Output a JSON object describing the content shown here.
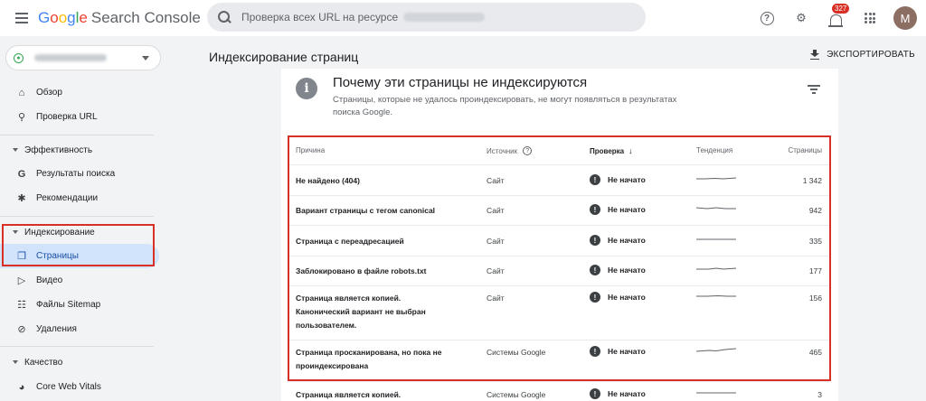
{
  "app": {
    "logo_g": "G",
    "logo_o1": "o",
    "logo_o2": "o",
    "logo_g2": "g",
    "logo_l": "l",
    "logo_e": "e",
    "product": "Search Console"
  },
  "search": {
    "placeholder": "Проверка всех URL на ресурсе"
  },
  "header": {
    "notifications_count": "327",
    "avatar_letter": "M"
  },
  "sidebar": {
    "items": [
      {
        "label": "Обзор",
        "icon": "home-icon"
      },
      {
        "label": "Проверка URL",
        "icon": "search-icon"
      }
    ],
    "sections": [
      {
        "label": "Эффективность",
        "items": [
          {
            "label": "Результаты поиска",
            "icon": "google-g-icon"
          },
          {
            "label": "Рекомендации",
            "icon": "asterisk-icon"
          }
        ]
      },
      {
        "label": "Индексирование",
        "items": [
          {
            "label": "Страницы",
            "icon": "pages-icon",
            "active": true
          },
          {
            "label": "Видео",
            "icon": "video-icon"
          },
          {
            "label": "Файлы Sitemap",
            "icon": "sitemap-icon"
          },
          {
            "label": "Удаления",
            "icon": "removals-icon"
          }
        ]
      },
      {
        "label": "Качество",
        "items": [
          {
            "label": "Core Web Vitals",
            "icon": "gauge-icon"
          }
        ]
      }
    ]
  },
  "main": {
    "title": "Индексирование страниц",
    "export_label": "ЭКСПОРТИРОВАТЬ",
    "card": {
      "title": "Почему эти страницы не индексируются",
      "subtitle": "Страницы, которые не удалось проиндексировать, не могут появляться в результатах поиска Google."
    },
    "table": {
      "headers": {
        "reason": "Причина",
        "source": "Источник",
        "status": "Проверка",
        "trend": "Тенденция",
        "pages": "Страницы"
      },
      "rows": [
        {
          "reason": "Не найдено (404)",
          "source": "Сайт",
          "status": "Не начато",
          "pages": "1 342"
        },
        {
          "reason": "Вариант страницы с тегом canonical",
          "source": "Сайт",
          "status": "Не начато",
          "pages": "942"
        },
        {
          "reason": "Страница с переадресацией",
          "source": "Сайт",
          "status": "Не начато",
          "pages": "335"
        },
        {
          "reason": "Заблокировано в файле robots.txt",
          "source": "Сайт",
          "status": "Не начато",
          "pages": "177"
        },
        {
          "reason": "Страница является копией. Канонический вариант не выбран пользователем.",
          "source": "Сайт",
          "status": "Не начато",
          "pages": "156"
        },
        {
          "reason": "Страница просканирована, но пока не проиндексирована",
          "source": "Системы Google",
          "status": "Не начато",
          "pages": "465"
        },
        {
          "reason": "Страница является копией.",
          "source": "Системы Google",
          "status": "Не начато",
          "pages": "3"
        }
      ]
    }
  },
  "colors": {
    "accent": "#1a73e8",
    "highlight": "#d93025",
    "active_bg": "#d2e3fc"
  }
}
